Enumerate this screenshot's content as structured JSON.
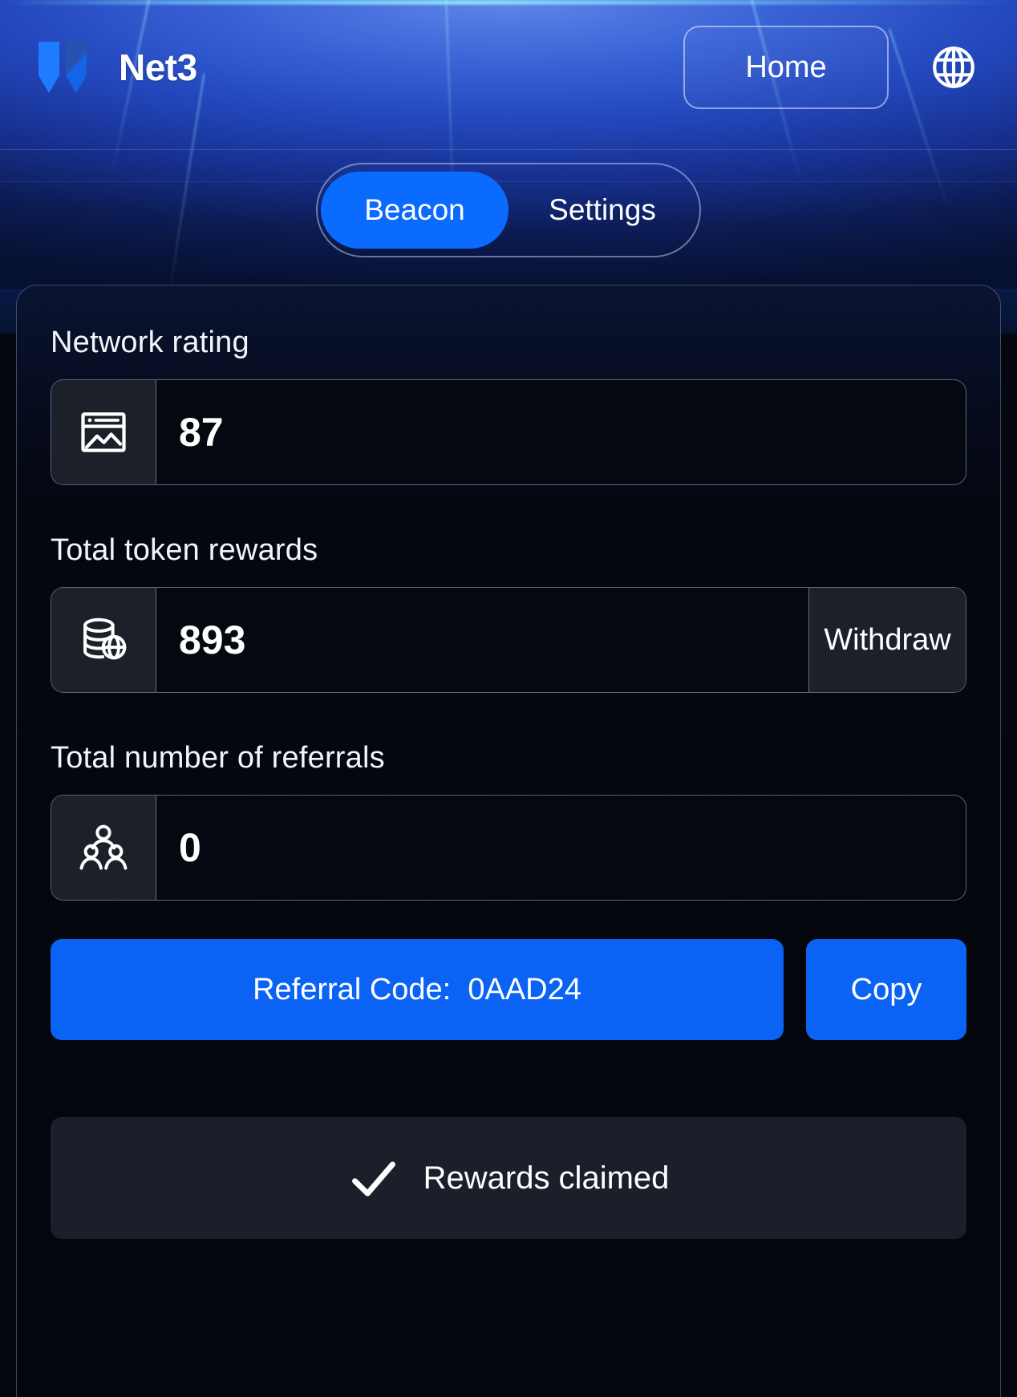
{
  "theme": {
    "accent_blue": "#0b63f6",
    "tab_active_blue": "#0b6bff",
    "card_bg": "#03060d",
    "icon_box_bg": "#1b2029",
    "claimed_bg": "#1a1f29",
    "text_primary": "#ffffff"
  },
  "header": {
    "brand_name": "Net3",
    "logo_icon": "net3-shield-logo",
    "home_label": "Home",
    "language_icon": "globe-icon"
  },
  "tabs": [
    {
      "label": "Beacon",
      "active": true
    },
    {
      "label": "Settings",
      "active": false
    }
  ],
  "main": {
    "fields": [
      {
        "label": "Network rating",
        "icon": "chart-window-icon",
        "value": "87",
        "action": null
      },
      {
        "label": "Total token rewards",
        "icon": "database-globe-icon",
        "value": "893",
        "action": "Withdraw"
      },
      {
        "label": "Total number of referrals",
        "icon": "people-group-icon",
        "value": "0",
        "action": null
      }
    ],
    "referral": {
      "code_label": "Referral Code:  0AAD24",
      "copy_label": "Copy"
    },
    "claimed": {
      "icon": "check-icon",
      "label": "Rewards claimed"
    }
  }
}
